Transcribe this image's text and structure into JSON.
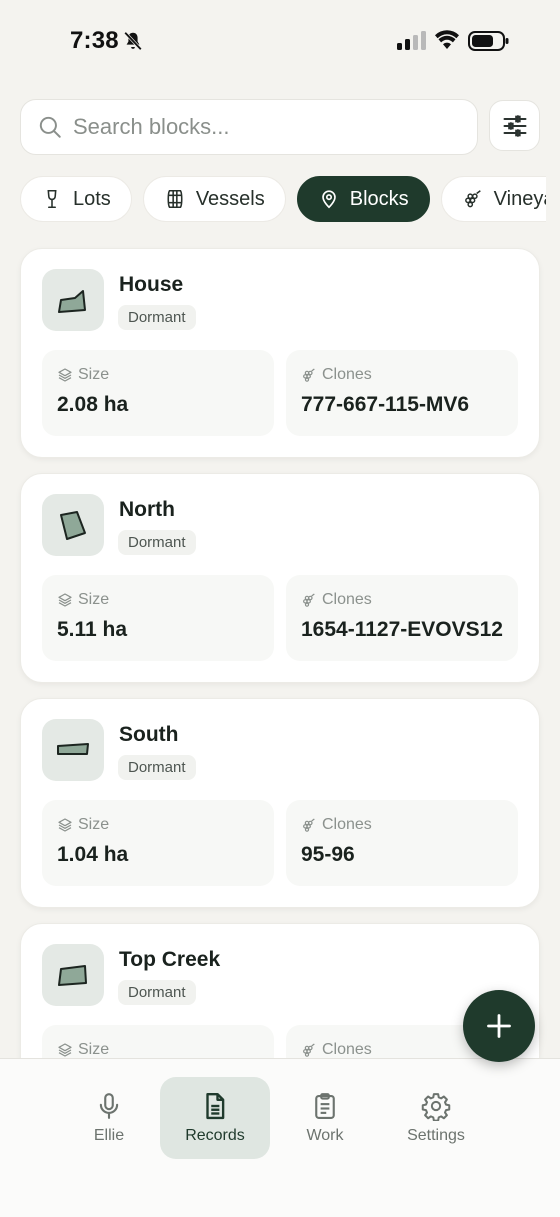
{
  "status_bar": {
    "time": "7:38"
  },
  "search": {
    "placeholder": "Search blocks..."
  },
  "chips": [
    {
      "label": "Lots",
      "icon": "wine-glass-icon",
      "active": false
    },
    {
      "label": "Vessels",
      "icon": "barrel-icon",
      "active": false
    },
    {
      "label": "Blocks",
      "icon": "map-pin-icon",
      "active": true
    },
    {
      "label": "Vineyards",
      "icon": "grapes-icon",
      "active": false
    }
  ],
  "stat_labels": {
    "size": "Size",
    "clones": "Clones"
  },
  "blocks": [
    {
      "name": "House",
      "status": "Dormant",
      "size": "2.08 ha",
      "clones": "777-667-115-MV6"
    },
    {
      "name": "North",
      "status": "Dormant",
      "size": "5.11 ha",
      "clones": "1654-1127-EVOVS12"
    },
    {
      "name": "South",
      "status": "Dormant",
      "size": "1.04 ha",
      "clones": "95-96"
    },
    {
      "name": "Top Creek",
      "status": "Dormant",
      "size": "",
      "clones": ""
    }
  ],
  "nav": [
    {
      "label": "Ellie",
      "icon": "microphone-icon",
      "active": false
    },
    {
      "label": "Records",
      "icon": "document-icon",
      "active": true
    },
    {
      "label": "Work",
      "icon": "clipboard-icon",
      "active": false
    },
    {
      "label": "Settings",
      "icon": "gear-icon",
      "active": false
    }
  ],
  "colors": {
    "accent": "#1f3a2c",
    "background": "#f4f3ef",
    "card": "#ffffff"
  }
}
